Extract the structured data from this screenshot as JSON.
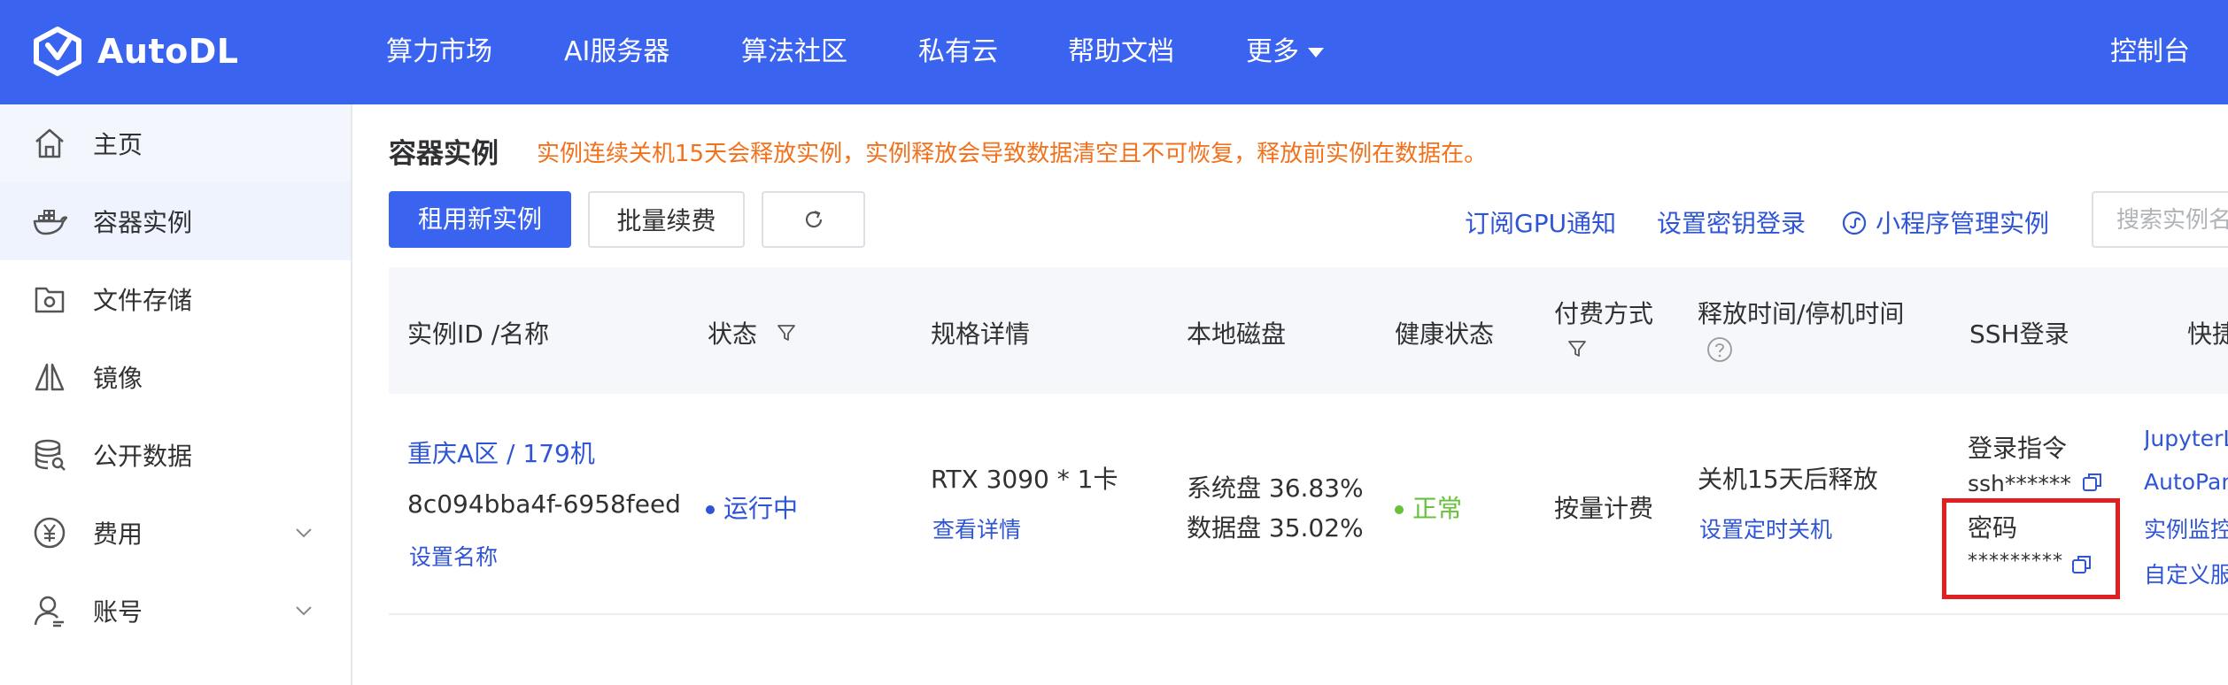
{
  "app": {
    "logo_text": "AutoDL"
  },
  "nav": {
    "items": [
      "算力市场",
      "AI服务器",
      "算法社区",
      "私有云",
      "帮助文档",
      "更多"
    ],
    "console": "控制台"
  },
  "sidebar": {
    "items": [
      {
        "label": "主页",
        "icon": "home-icon"
      },
      {
        "label": "容器实例",
        "icon": "docker-icon"
      },
      {
        "label": "文件存储",
        "icon": "storage-icon"
      },
      {
        "label": "镜像",
        "icon": "image-icon"
      },
      {
        "label": "公开数据",
        "icon": "database-icon"
      },
      {
        "label": "费用",
        "icon": "yen-icon"
      },
      {
        "label": "账号",
        "icon": "user-icon"
      }
    ]
  },
  "page": {
    "title": "容器实例",
    "warning": "实例连续关机15天会释放实例，实例释放会导致数据清空且不可恢复，释放前实例在数据在。"
  },
  "toolbar": {
    "rent_new": "租用新实例",
    "batch_renew": "批量续费",
    "subscribe_gpu": "订阅GPU通知",
    "set_key_login": "设置密钥登录",
    "mini_program": "小程序管理实例",
    "search_placeholder": "搜索实例名"
  },
  "table": {
    "headers": {
      "id_name": "实例ID /名称",
      "status": "状态",
      "spec": "规格详情",
      "disk": "本地磁盘",
      "health": "健康状态",
      "billing_line1": "付费方式",
      "release_line1": "释放时间/停机时间",
      "ssh": "SSH登录",
      "tools": "快捷工具"
    },
    "row": {
      "region": "重庆A区 / 179机",
      "instance_id": "8c094bba4f-6958feed",
      "set_name": "设置名称",
      "status": "运行中",
      "gpu": "RTX 3090 * 1卡",
      "view_details": "查看详情",
      "disk_system": "系统盘 36.83%",
      "disk_data": "数据盘 35.02%",
      "health": "正常",
      "billing": "按量计费",
      "release": "关机15天后释放",
      "set_shutdown": "设置定时关机",
      "ssh_label": "登录指令",
      "ssh_value": "ssh******",
      "password_label": "密码",
      "password_value": "*********",
      "tools": [
        "JupyterLab",
        "AutoPanel",
        "实例监控",
        "自定义服务"
      ]
    }
  },
  "colors": {
    "nav_bg": "#3a63f0",
    "link": "#2f55d4",
    "warning": "#f2711c",
    "running": "#2f55d4",
    "healthy": "#67c23a",
    "highlight_box": "#e02020"
  }
}
